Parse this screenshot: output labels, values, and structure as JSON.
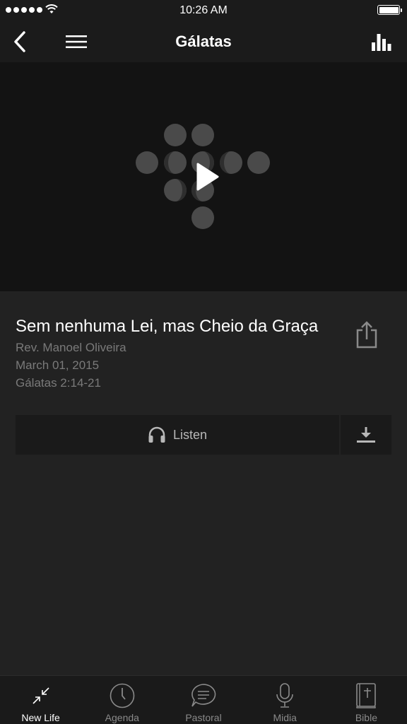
{
  "status_bar": {
    "time": "10:26 AM"
  },
  "nav": {
    "title": "Gálatas",
    "back_icon": "chevron-left-icon",
    "menu_icon": "hamburger-menu-icon",
    "stats_icon": "bar-chart-icon"
  },
  "media": {
    "logo_icon": "church-cross-dots-logo",
    "play_icon": "play-icon"
  },
  "sermon": {
    "title": "Sem nenhuma Lei, mas Cheio da Graça",
    "speaker": "Rev. Manoel Oliveira",
    "date": "March 01, 2015",
    "passage": "Gálatas 2:14-21",
    "share_icon": "share-icon"
  },
  "actions": {
    "listen_label": "Listen",
    "listen_icon": "headphones-icon",
    "download_icon": "download-icon"
  },
  "tabs": [
    {
      "label": "New Life",
      "icon": "arrows-in-icon",
      "active": true
    },
    {
      "label": "Agenda",
      "icon": "clock-icon",
      "active": false
    },
    {
      "label": "Pastoral",
      "icon": "chat-bubble-icon",
      "active": false
    },
    {
      "label": "Midia",
      "icon": "microphone-icon",
      "active": false
    },
    {
      "label": "Bible",
      "icon": "bible-icon",
      "active": false
    }
  ],
  "colors": {
    "background": "#222222",
    "bars": "#1b1b1b",
    "media_background": "#131313",
    "muted_text": "#7a7a7a"
  }
}
